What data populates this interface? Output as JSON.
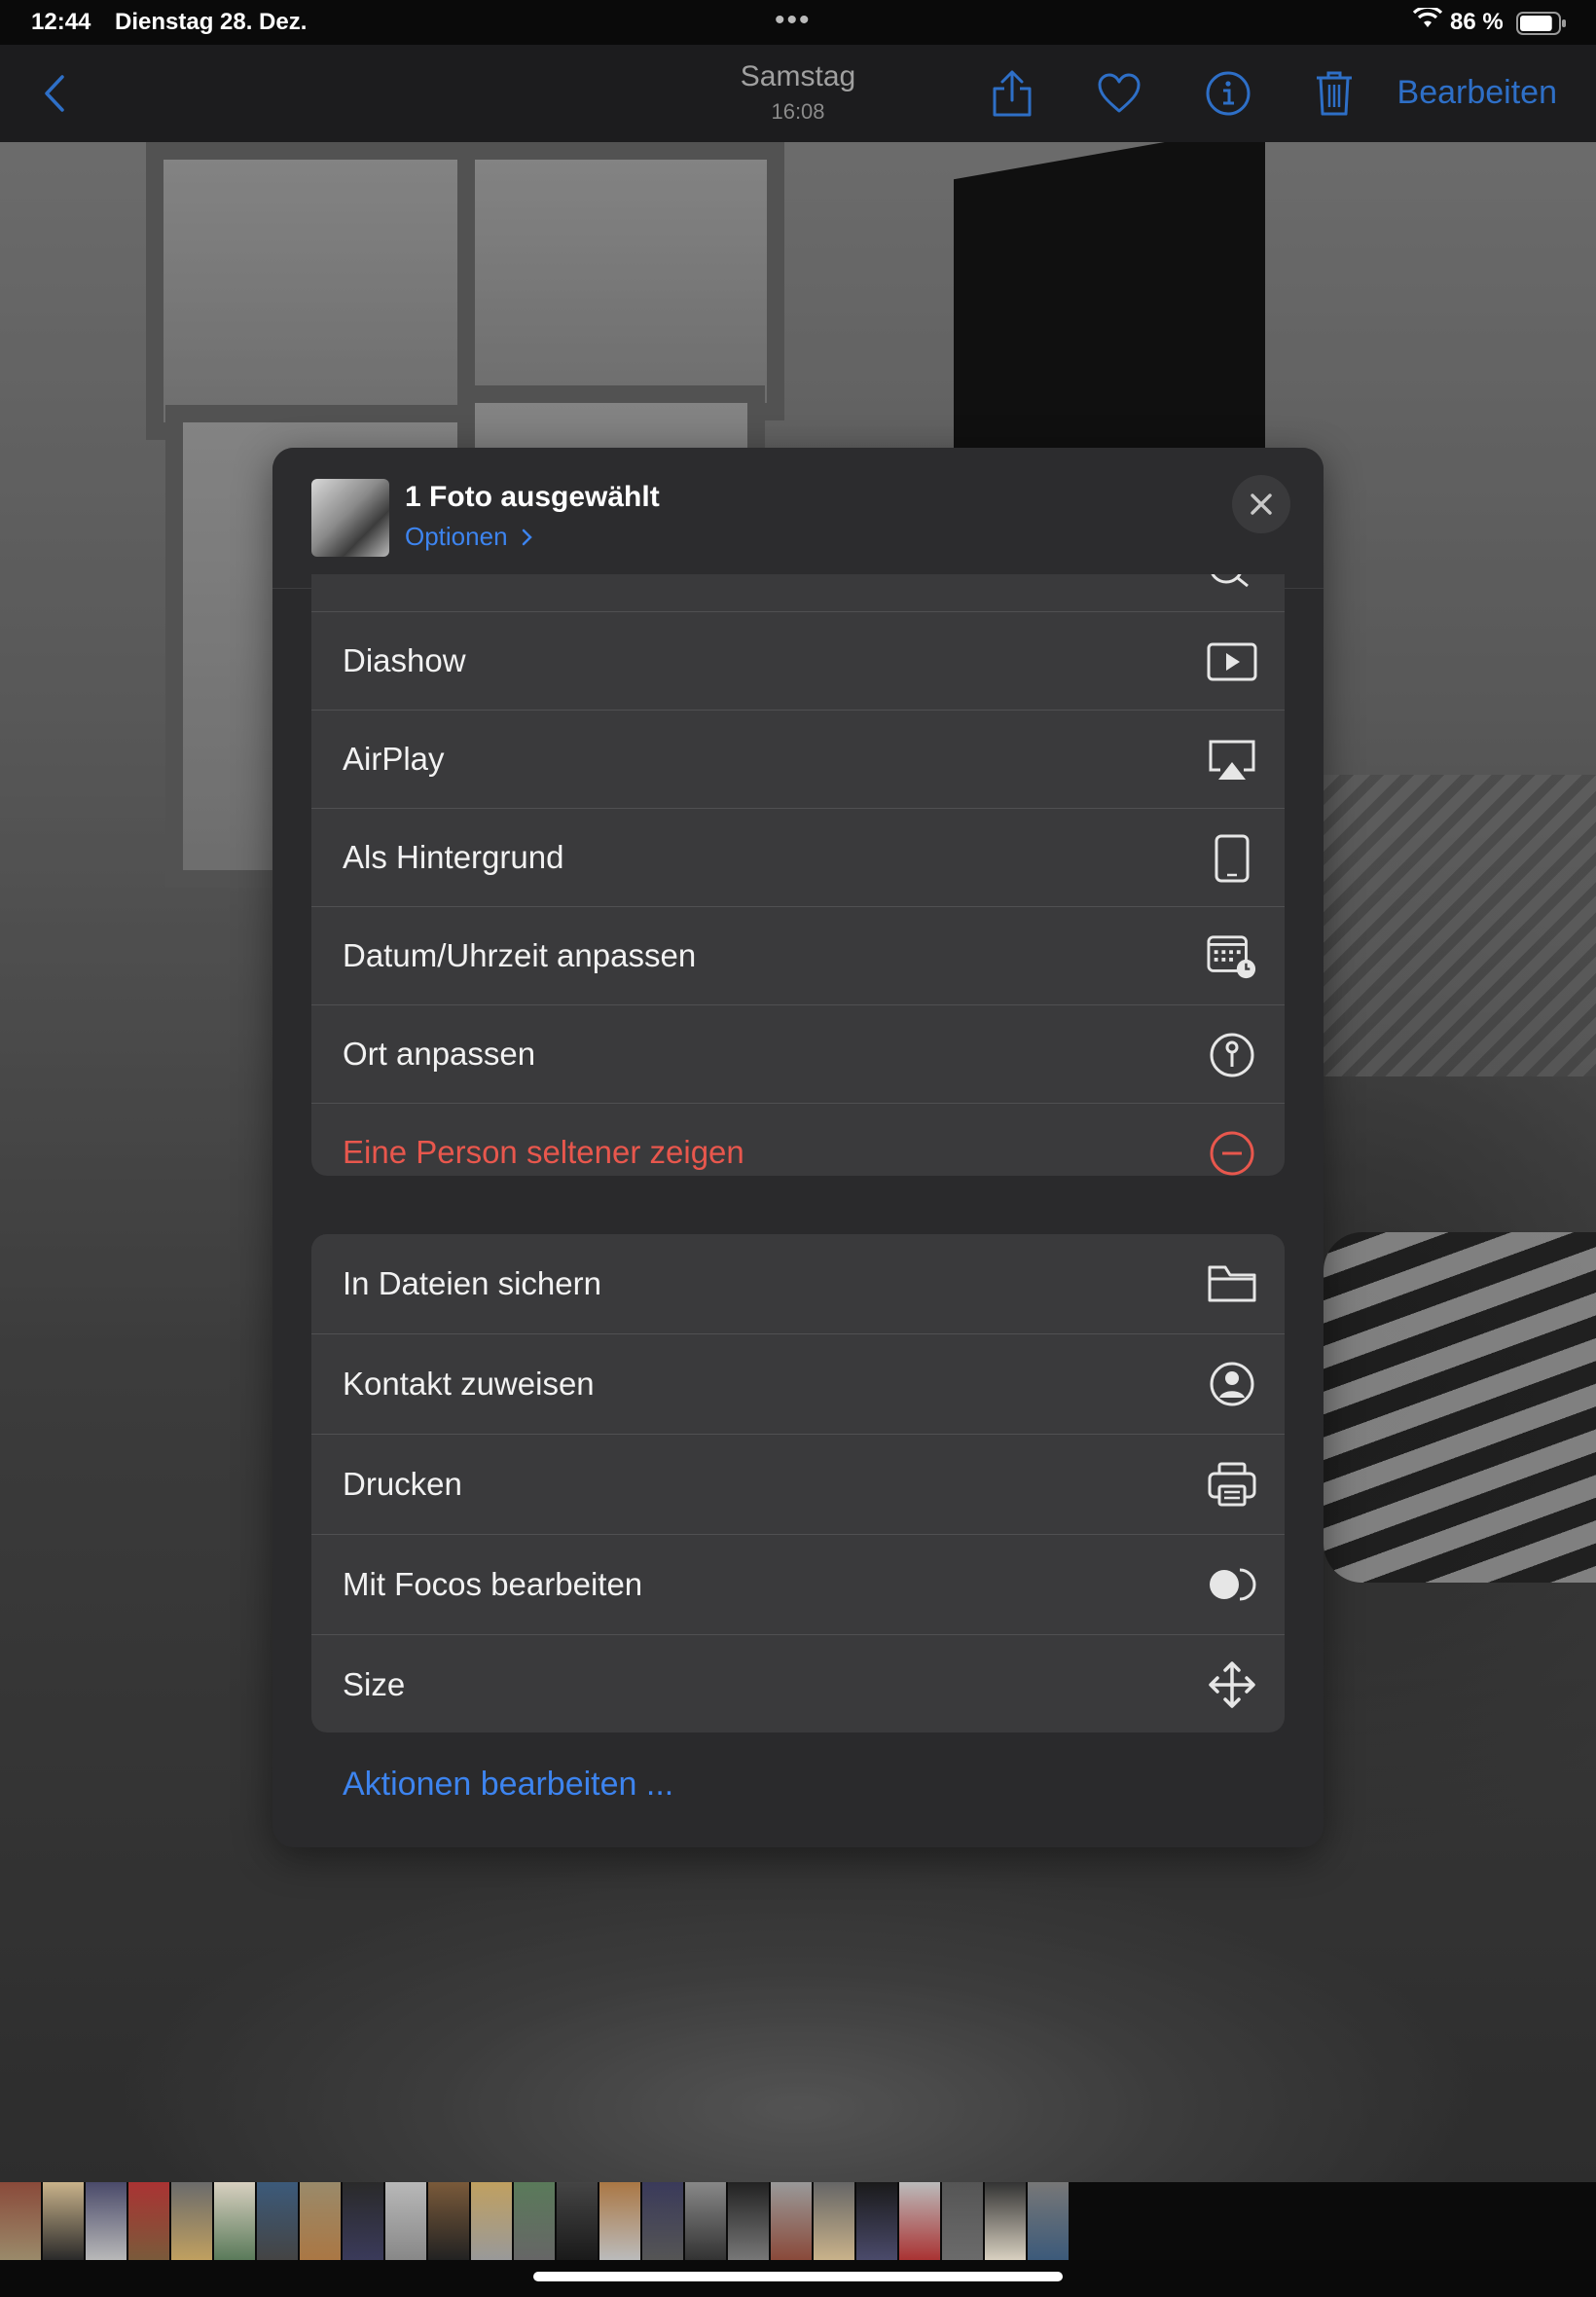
{
  "status_bar": {
    "time": "12:44",
    "date": "Dienstag 28. Dez.",
    "battery_text": "86 %",
    "battery_level": 0.86
  },
  "nav": {
    "title": "Samstag",
    "subtitle": "16:08",
    "edit_label": "Bearbeiten",
    "icons": [
      "back-chevron-icon",
      "share-icon",
      "heart-icon",
      "info-icon",
      "trash-icon"
    ],
    "accent_color": "#2e6fc7"
  },
  "sheet": {
    "title": "1 Foto ausgewählt",
    "options_label": "Optionen",
    "group1": [
      {
        "label": "Diashow",
        "icon": "play-rectangle-icon"
      },
      {
        "label": "AirPlay",
        "icon": "airplay-icon"
      },
      {
        "label": "Als Hintergrund",
        "icon": "ipad-icon"
      },
      {
        "label": "Datum/Uhrzeit anpassen",
        "icon": "calendar-clock-icon"
      },
      {
        "label": "Ort anpassen",
        "icon": "location-pin-circle-icon"
      },
      {
        "label": "Eine Person seltener zeigen",
        "icon": "minus-circle-icon",
        "color": "#e8574d"
      }
    ],
    "group2": [
      {
        "label": "In Dateien sichern",
        "icon": "folder-icon"
      },
      {
        "label": "Kontakt zuweisen",
        "icon": "person-circle-icon"
      },
      {
        "label": "Drucken",
        "icon": "printer-icon"
      },
      {
        "label": "Mit Focos bearbeiten",
        "icon": "half-circle-icon"
      },
      {
        "label": "Size",
        "icon": "move-arrows-icon"
      }
    ],
    "edit_actions_label": "Aktionen bearbeiten ..."
  }
}
